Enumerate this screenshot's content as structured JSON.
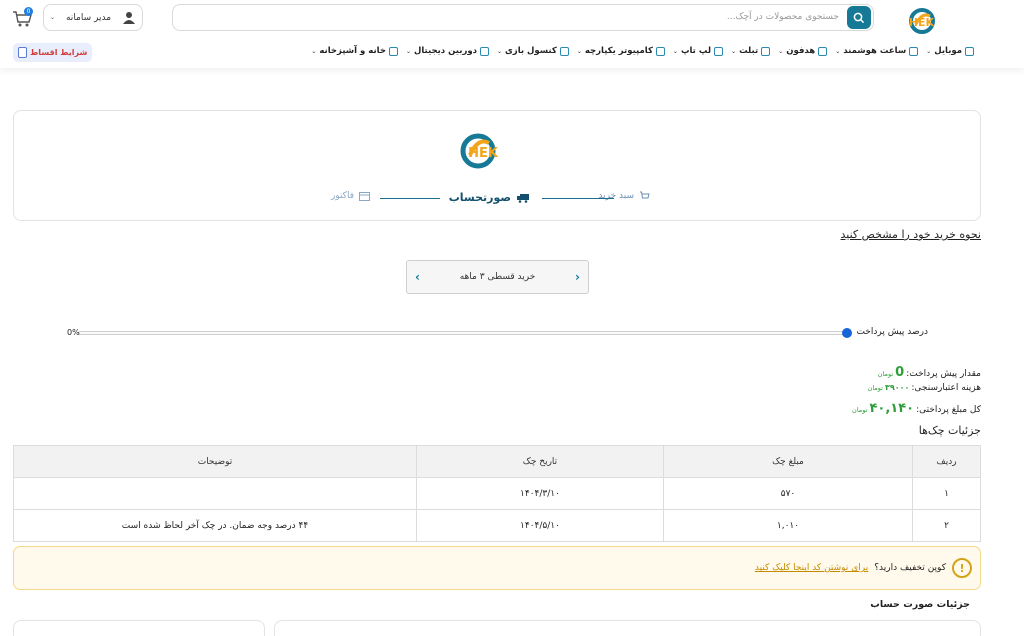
{
  "header": {
    "brand_text": "آچک HEK",
    "search_placeholder": "جستجوی محصولات در آچک...",
    "user_name": "مدیر سامانه",
    "cart_count": "0",
    "install_button": "شرایط اقساط"
  },
  "nav": [
    {
      "label": "موبایل"
    },
    {
      "label": "ساعت هوشمند"
    },
    {
      "label": "هدفون"
    },
    {
      "label": "تبلت"
    },
    {
      "label": "لپ تاپ"
    },
    {
      "label": "کامپیوتر یکپارچه"
    },
    {
      "label": "کنسول بازی"
    },
    {
      "label": "دوربین دیجیتال"
    },
    {
      "label": "خانه و آشپزخانه"
    }
  ],
  "steps": {
    "cart": "سبد خرید",
    "invoice": "صورتحساب",
    "factor": "فاکتور"
  },
  "method_link": "نحوه خرید خود را مشخص کنید",
  "plan_selector": {
    "label": "خرید قسطی ۳ ماهه"
  },
  "prepayment": {
    "label": "درصد پیش پرداخت",
    "value": "0%",
    "percent": 0
  },
  "summary": {
    "prepay_label": "مقدار پیش پرداخت:",
    "prepay_value": "0",
    "credit_label": "هزینه اعتبارسنجی:",
    "credit_value": "۳۹۰۰۰",
    "total_label": "کل مبلغ پرداختی:",
    "total_value": "۴۰,۱۴۰",
    "unit": "تومان"
  },
  "checks": {
    "title": "جزئیات چک‌ها",
    "headers": [
      "ردیف",
      "مبلغ چک",
      "تاریخ چک",
      "توضیحات"
    ],
    "rows": [
      {
        "index": "۱",
        "amount": "۵۷۰",
        "date": "۱۴۰۴/۳/۱۰",
        "note": ""
      },
      {
        "index": "۲",
        "amount": "۱,۰۱۰",
        "date": "۱۴۰۴/۵/۱۰",
        "note": "۴۴ درصد وجه ضمان. در چک آخر لحاظ شده است"
      }
    ]
  },
  "coupon": {
    "question": "کوپن تخفیف دارید؟",
    "link": "برای نوشتن کد اینجا کلیک کنید"
  },
  "invoice_details_title": "جزئیات صورت حساب",
  "colors": {
    "primary": "#167996",
    "success": "#2e9d3a",
    "warning": "#d4a316"
  }
}
